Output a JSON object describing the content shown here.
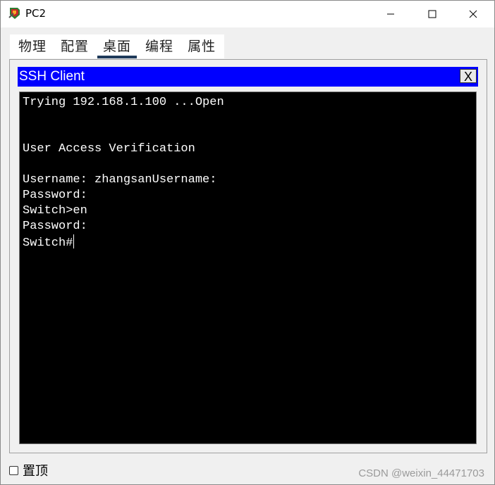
{
  "window": {
    "title": "PC2",
    "icon": "packet-tracer-pc-icon"
  },
  "tabs": [
    {
      "label": "物理",
      "active": false
    },
    {
      "label": "配置",
      "active": false
    },
    {
      "label": "桌面",
      "active": true
    },
    {
      "label": "编程",
      "active": false
    },
    {
      "label": "属性",
      "active": false
    }
  ],
  "ssh": {
    "title": "SSH Client",
    "close_label": "X"
  },
  "terminal": {
    "lines": [
      "Trying 192.168.1.100 ...Open",
      "",
      "",
      "User Access Verification",
      "",
      "Username: zhangsanUsername:",
      "Password:",
      "Switch>en",
      "Password:",
      "Switch#"
    ]
  },
  "footer": {
    "topmost_label": "置顶",
    "topmost_checked": false,
    "watermark": "CSDN @weixin_44471703"
  },
  "colors": {
    "ssh_header": "#0000ff",
    "terminal_bg": "#000000",
    "terminal_fg": "#ffffff",
    "active_tab_underline": "#1f3a5a"
  }
}
